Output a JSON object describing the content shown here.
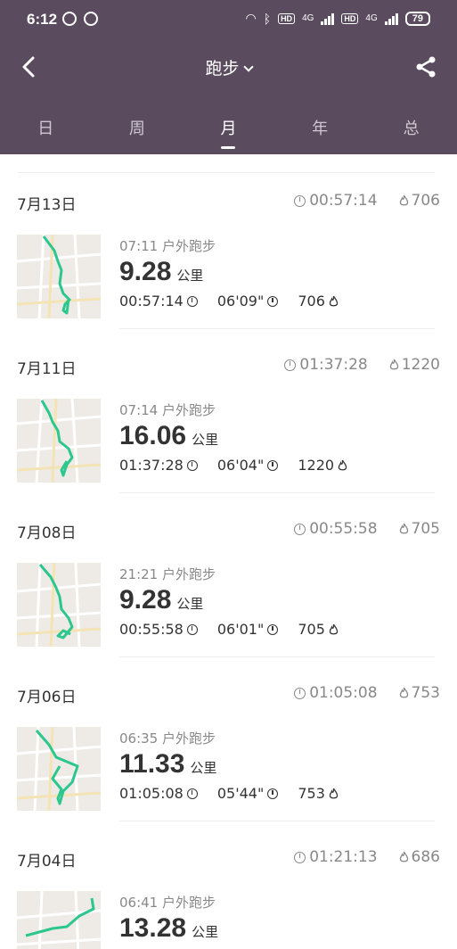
{
  "status_bar": {
    "time": "6:12",
    "battery": "79",
    "net1": "4G",
    "net2": "4G",
    "hd": "HD"
  },
  "nav": {
    "title": "跑步"
  },
  "tabs": [
    "日",
    "周",
    "月",
    "年",
    "总"
  ],
  "active_tab": 2,
  "days": [
    {
      "date": "7月13日",
      "total_time": "00:57:14",
      "total_cal": "706",
      "workout": {
        "time": "07:11",
        "type": "户外跑步",
        "distance": "9.28",
        "unit": "公里",
        "duration": "00:57:14",
        "pace": "06'09\"",
        "calories": "706"
      }
    },
    {
      "date": "7月11日",
      "total_time": "01:37:28",
      "total_cal": "1220",
      "workout": {
        "time": "07:14",
        "type": "户外跑步",
        "distance": "16.06",
        "unit": "公里",
        "duration": "01:37:28",
        "pace": "06'04\"",
        "calories": "1220"
      }
    },
    {
      "date": "7月08日",
      "total_time": "00:55:58",
      "total_cal": "705",
      "workout": {
        "time": "21:21",
        "type": "户外跑步",
        "distance": "9.28",
        "unit": "公里",
        "duration": "00:55:58",
        "pace": "06'01\"",
        "calories": "705"
      }
    },
    {
      "date": "7月06日",
      "total_time": "01:05:08",
      "total_cal": "753",
      "workout": {
        "time": "06:35",
        "type": "户外跑步",
        "distance": "11.33",
        "unit": "公里",
        "duration": "01:05:08",
        "pace": "05'44\"",
        "calories": "753"
      }
    },
    {
      "date": "7月04日",
      "total_time": "01:21:13",
      "total_cal": "686",
      "workout": {
        "time": "06:41",
        "type": "户外跑步",
        "distance": "13.28",
        "unit": "公里",
        "duration": "",
        "pace": "",
        "calories": ""
      }
    }
  ],
  "colors": {
    "header_bg": "#5a4c5e",
    "route": "#2cc68f"
  }
}
